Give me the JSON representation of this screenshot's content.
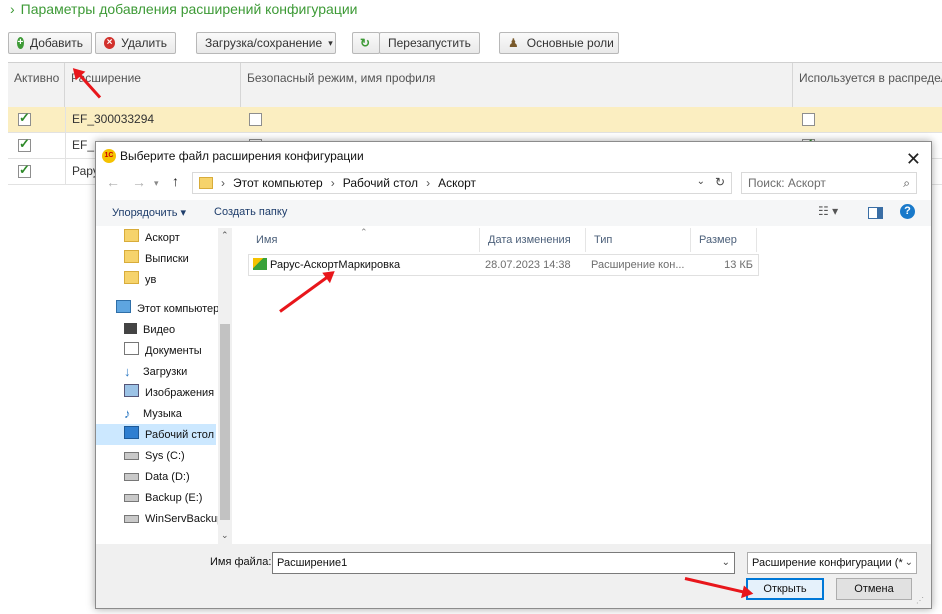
{
  "page": {
    "title": "Параметры добавления расширений конфигурации"
  },
  "toolbar": {
    "add_label": "Добавить",
    "delete_label": "Удалить",
    "load_save_label": "Загрузка/сохранение",
    "restart_label": "Перезапустить",
    "roles_label": "Основные роли"
  },
  "grid": {
    "columns": [
      "Активно",
      "Расширение",
      "Безопасный режим, имя профиля",
      "Используется в распредел"
    ],
    "rows": [
      {
        "active": true,
        "name": "EF_300033294",
        "safe": false,
        "used": false
      },
      {
        "active": true,
        "name": "EF_",
        "safe": false,
        "used": true
      },
      {
        "active": true,
        "name": "Рару",
        "safe": false,
        "used": false
      }
    ]
  },
  "dialog": {
    "title": "Выберите файл расширения конфигурации",
    "logo_text": "1С",
    "path": [
      "Этот компьютер",
      "Рабочий стол",
      "Аскорт"
    ],
    "search_placeholder": "Поиск: Аскорт",
    "organize_label": "Упорядочить ▾",
    "new_folder_label": "Создать папку",
    "nav_items": [
      {
        "label": "Аскорт",
        "icon": "folder-icon"
      },
      {
        "label": "Выписки",
        "icon": "folder-icon"
      },
      {
        "label": "ув",
        "icon": "folder-icon"
      },
      {
        "label": "Этот компьютер",
        "icon": "computer-icon"
      },
      {
        "label": "Видео",
        "icon": "video-icon"
      },
      {
        "label": "Документы",
        "icon": "document-icon"
      },
      {
        "label": "Загрузки",
        "icon": "download-icon"
      },
      {
        "label": "Изображения",
        "icon": "image-icon"
      },
      {
        "label": "Музыка",
        "icon": "music-icon"
      },
      {
        "label": "Рабочий стол",
        "icon": "desktop-icon"
      },
      {
        "label": "Sys (C:)",
        "icon": "drive-icon"
      },
      {
        "label": "Data (D:)",
        "icon": "drive-icon"
      },
      {
        "label": "Backup (E:)",
        "icon": "drive-icon"
      },
      {
        "label": "WinServBackup",
        "icon": "drive-icon"
      }
    ],
    "columns": {
      "name": "Имя",
      "date": "Дата изменения",
      "type": "Тип",
      "size": "Размер"
    },
    "files": [
      {
        "name": "Рарус-АскортМаркировка",
        "date": "28.07.2023 14:38",
        "type": "Расширение кон...",
        "size": "13 КБ"
      }
    ],
    "filename_label": "Имя файла:",
    "filename_value": "Расширение1",
    "filter_value": "Расширение конфигурации (*",
    "open_label": "Открыть",
    "cancel_label": "Отмена"
  },
  "colors": {
    "accent_green": "#3d9a36",
    "selected_row": "#fbeec1",
    "arrow_red": "#e8161b",
    "nav_selected": "#cce8ff"
  }
}
